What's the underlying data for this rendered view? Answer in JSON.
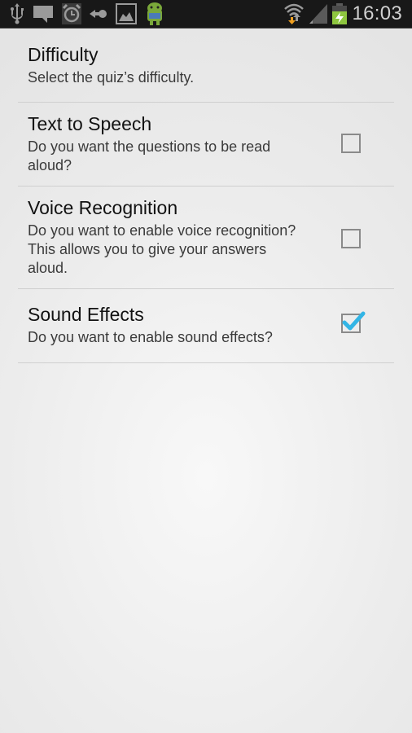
{
  "status_bar": {
    "left_icons": [
      "usb-icon",
      "message-icon",
      "alarm-icon",
      "back-arrow-icon",
      "image-icon",
      "android-icon"
    ],
    "right_icons": [
      "wifi-icon",
      "signal-icon",
      "battery-charging-icon"
    ],
    "time": "16:03",
    "battery_color": "#8ec63f",
    "wifi_arrow_color": "#f0a020"
  },
  "preferences": [
    {
      "title": "Difficulty",
      "summary": "Select the quiz’s difficulty.",
      "has_checkbox": false
    },
    {
      "title": "Text to Speech",
      "summary": "Do you want the questions to be read aloud?",
      "has_checkbox": true,
      "checked": false
    },
    {
      "title": "Voice Recognition",
      "summary": "Do you want to enable voice recognition? This allows you to give your answers aloud.",
      "has_checkbox": true,
      "checked": false
    },
    {
      "title": "Sound Effects",
      "summary": "Do you want to enable sound effects?",
      "has_checkbox": true,
      "checked": true
    }
  ],
  "colors": {
    "checkmark": "#33b5e5"
  }
}
